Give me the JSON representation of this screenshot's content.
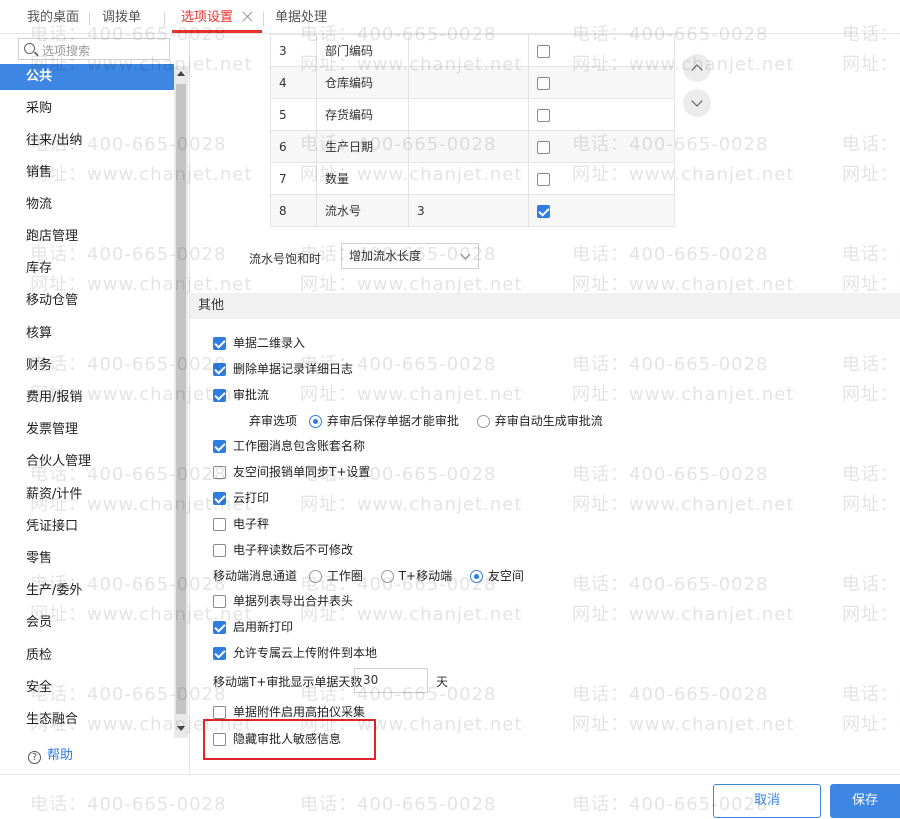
{
  "tabs": [
    {
      "label": "我的桌面"
    },
    {
      "label": "调拨单"
    },
    {
      "label": "选项设置"
    },
    {
      "label": "单据处理"
    }
  ],
  "sidebar": {
    "search_placeholder": "选项搜索",
    "items": [
      {
        "label": "公共"
      },
      {
        "label": "采购"
      },
      {
        "label": "往来/出纳"
      },
      {
        "label": "销售"
      },
      {
        "label": "物流"
      },
      {
        "label": "跑店管理"
      },
      {
        "label": "库存"
      },
      {
        "label": "移动仓管"
      },
      {
        "label": "核算"
      },
      {
        "label": "财务"
      },
      {
        "label": "费用/报销"
      },
      {
        "label": "发票管理"
      },
      {
        "label": "合伙人管理"
      },
      {
        "label": "薪资/计件"
      },
      {
        "label": "凭证接口"
      },
      {
        "label": "零售"
      },
      {
        "label": "生产/委外"
      },
      {
        "label": "会员"
      },
      {
        "label": "质检"
      },
      {
        "label": "安全"
      },
      {
        "label": "生态融合"
      }
    ],
    "help_label": "帮助",
    "help_icon": "?"
  },
  "code_table": {
    "rows": [
      {
        "no": "3",
        "name": "部门编码",
        "length": "",
        "checked": false
      },
      {
        "no": "4",
        "name": "仓库编码",
        "length": "",
        "checked": false
      },
      {
        "no": "5",
        "name": "存货编码",
        "length": "",
        "checked": false
      },
      {
        "no": "6",
        "name": "生产日期",
        "length": "",
        "checked": false
      },
      {
        "no": "7",
        "name": "数量",
        "length": "",
        "checked": false
      },
      {
        "no": "8",
        "name": "流水号",
        "length": "3",
        "checked": true
      }
    ]
  },
  "flow": {
    "label": "流水号饱和时",
    "value": "增加流水长度"
  },
  "section_title": "其他",
  "options": {
    "o1": {
      "label": "单据二维录入",
      "checked": true
    },
    "o2": {
      "label": "删除单据记录详细日志",
      "checked": true
    },
    "o3": {
      "label": "审批流",
      "checked": true
    },
    "abandon": {
      "label": "弃审选项",
      "opt1": "弃审后保存单据才能审批",
      "opt2": "弃审自动生成审批流",
      "selected": 1
    },
    "o4": {
      "label": "工作圈消息包含账套名称",
      "checked": true
    },
    "o5": {
      "label": "友空间报销单同步T+设置",
      "checked": false
    },
    "o6": {
      "label": "云打印",
      "checked": true
    },
    "o7": {
      "label": "电子秤",
      "checked": false
    },
    "o8": {
      "label": "电子秤读数后不可修改",
      "checked": false
    },
    "channel": {
      "label": "移动端消息通道",
      "opt1": "工作圈",
      "opt2": "T+移动端",
      "opt3": "友空间",
      "selected": 3
    },
    "o9": {
      "label": "单据列表导出合并表头",
      "checked": false
    },
    "o10": {
      "label": "启用新打印",
      "checked": true
    },
    "o11": {
      "label": "允许专属云上传附件到本地",
      "checked": true
    },
    "days": {
      "label": "移动端T+审批显示单据天数",
      "value": "30",
      "unit": "天"
    },
    "o12": {
      "label": "单据附件启用高拍仪采集",
      "checked": false
    },
    "o13": {
      "label": "隐藏审批人敏感信息",
      "checked": false
    }
  },
  "footer": {
    "cancel": "取消",
    "save": "保存"
  },
  "watermark": {
    "phone": "电话：400-665-0028",
    "site": "网址：www.chanjet.net"
  }
}
